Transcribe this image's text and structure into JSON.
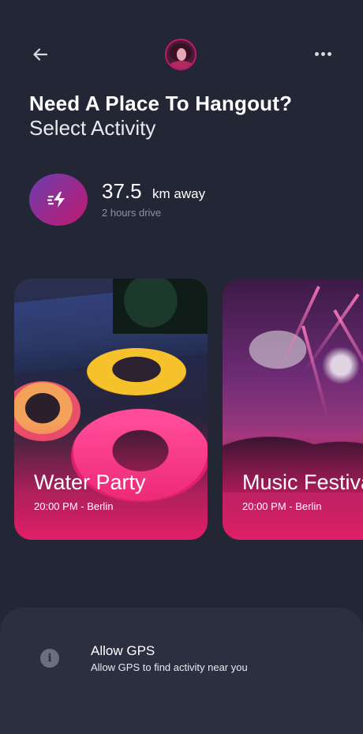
{
  "header": {
    "back_icon": "arrow-left-icon",
    "avatar_icon": "user-avatar",
    "more_icon": "more-horizontal-icon"
  },
  "page": {
    "title": "Need A Place To Hangout?",
    "subtitle": "Select Activity"
  },
  "distance": {
    "icon": "lightning-speed-icon",
    "value": "37.5",
    "unit": "km away",
    "sub": "2 hours drive"
  },
  "activities": [
    {
      "title": "Water Party",
      "subtitle": "20:00 PM - Berlin"
    },
    {
      "title": "Music Festival",
      "subtitle": "20:00 PM - Berlin"
    }
  ],
  "gps": {
    "icon": "info-icon",
    "title": "Allow GPS",
    "description": "Allow GPS to find activity near you"
  },
  "colors": {
    "background": "#232634",
    "accent_pink": "#e21f68",
    "accent_purple": "#6b3fb0",
    "panel": "#2b2f40"
  }
}
